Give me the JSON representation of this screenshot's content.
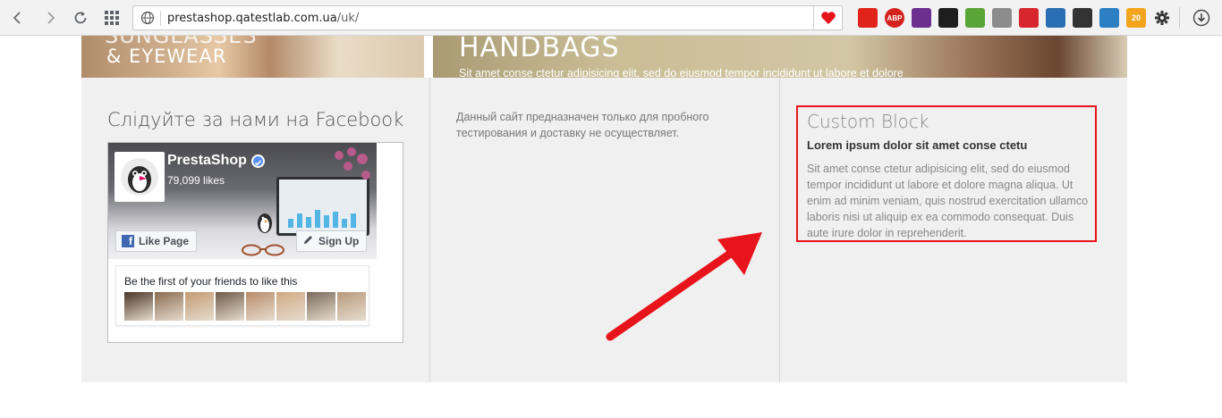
{
  "browser": {
    "url_host": "prestashop.qatestlab.com.ua",
    "url_path": "/uk/",
    "icons": {
      "back": "back-arrow-icon",
      "forward": "forward-arrow-icon",
      "reload": "reload-icon",
      "apps": "apps-grid-icon",
      "site_info": "globe-icon",
      "bookmark": "heart-icon",
      "menu": "gear-icon",
      "download": "download-icon"
    },
    "extensions": [
      {
        "name": "opera-extension-icon",
        "color": "#e0241b",
        "label": ""
      },
      {
        "name": "adblock-plus-icon",
        "color": "#d3231c",
        "label": "ABP"
      },
      {
        "name": "cross-extension-icon",
        "color": "#6d2f8f",
        "label": ""
      },
      {
        "name": "notes-extension-icon",
        "color": "#1e1e1e",
        "label": ""
      },
      {
        "name": "sync-extension-icon",
        "color": "#5aa538",
        "label": ""
      },
      {
        "name": "world-extension-icon",
        "color": "#8c8c8c",
        "label": ""
      },
      {
        "name": "shield-extension-icon",
        "color": "#d8262f",
        "label": ""
      },
      {
        "name": "book-extension-icon",
        "color": "#2a6fb5",
        "label": ""
      },
      {
        "name": "headphones-extension-icon",
        "color": "#333333",
        "label": ""
      },
      {
        "name": "globe-extension-icon",
        "color": "#2c7fc2",
        "label": ""
      },
      {
        "name": "weather-extension-icon",
        "color": "#f2a51c",
        "label": "20"
      }
    ]
  },
  "banners": {
    "left_line1": "SUNGLASSES",
    "left_line2": "& EYEWEAR",
    "right_title": "HANDBAGS",
    "right_subtitle": "Sit amet conse ctetur adipisicing elit, sed do eiusmod tempor incididunt ut labore et dolore"
  },
  "facebook": {
    "heading": "Слідуйте за нами на Facebook",
    "page_name": "PrestaShop",
    "likes": "79,099 likes",
    "like_button": "Like Page",
    "signup_button": "Sign Up",
    "friends_text": "Be the first of your friends to like this",
    "friend_avatars": [
      "#4a3526",
      "#8a6b50",
      "#c49a72",
      "#6e5a48",
      "#b88c6a",
      "#d1a983",
      "#7a6a5a",
      "#b79a7c"
    ],
    "brand_color": "#4267b2"
  },
  "info": {
    "text": "Данный сайт предназначен только для пробного тестирования и доставку не осуществляет."
  },
  "custom_block": {
    "title": "Custom Block",
    "subtitle": "Lorem ipsum dolor sit amet conse ctetu",
    "body": "Sit amet conse ctetur adipisicing elit, sed do eiusmod tempor incididunt ut labore et dolore magna aliqua. Ut enim ad minim veniam, quis nostrud exercitation ullamco laboris nisi ut aliquip ex ea commodo consequat. Duis aute irure dolor in reprehenderit.",
    "highlight_color": "#e8141b"
  }
}
